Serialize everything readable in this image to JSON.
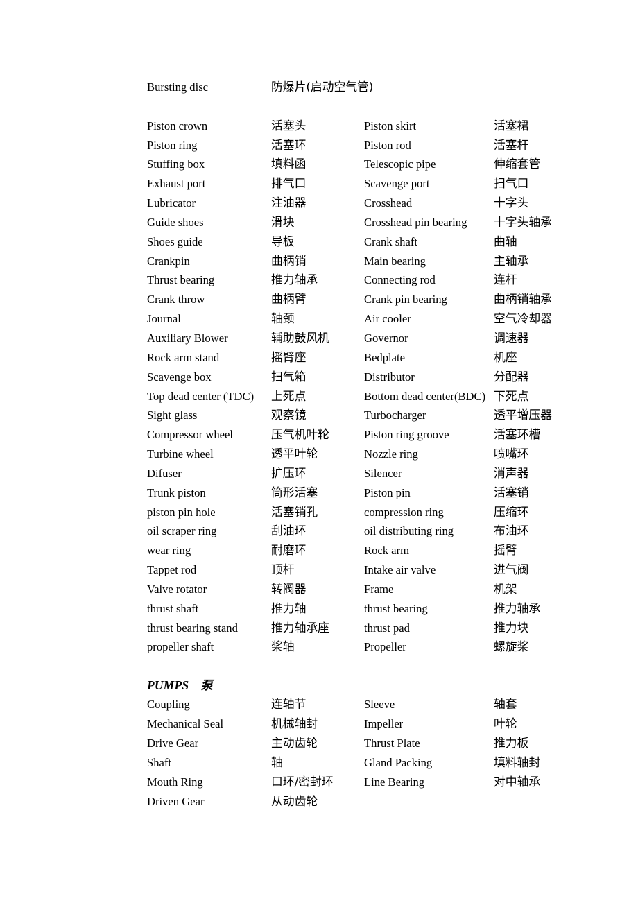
{
  "document": {
    "intro_row": {
      "en": "Bursting disc",
      "cn": "防爆片(启动空气管)"
    },
    "engine_rows": [
      {
        "en1": "Piston crown",
        "cn1": "活塞头",
        "en2": "Piston skirt",
        "cn2": "活塞裙"
      },
      {
        "en1": "Piston ring",
        "cn1": "活塞环",
        "en2": "Piston rod",
        "cn2": "活塞杆"
      },
      {
        "en1": "Stuffing box",
        "cn1": "填料函",
        "en2": "Telescopic pipe",
        "cn2": "伸缩套管"
      },
      {
        "en1": "Exhaust port",
        "cn1": "排气口",
        "en2": "Scavenge port",
        "cn2": "扫气口"
      },
      {
        "en1": "Lubricator",
        "cn1": "注油器",
        "en2": "Crosshead",
        "cn2": "十字头"
      },
      {
        "en1": "Guide shoes",
        "cn1": "滑块",
        "en2": "Crosshead pin bearing",
        "cn2": "十字头轴承"
      },
      {
        "en1": "Shoes guide",
        "cn1": "导板",
        "en2": "Crank shaft",
        "cn2": "曲轴"
      },
      {
        "en1": "Crankpin",
        "cn1": "曲柄销",
        "en2": "Main bearing",
        "cn2": "主轴承"
      },
      {
        "en1": "Thrust bearing",
        "cn1": "推力轴承",
        "en2": "Connecting rod",
        "cn2": "连杆"
      },
      {
        "en1": "Crank throw",
        "cn1": "曲柄臂",
        "en2": "Crank pin bearing",
        "cn2": "曲柄销轴承"
      },
      {
        "en1": "Journal",
        "cn1": "轴颈",
        "en2": "Air cooler",
        "cn2": "空气冷却器"
      },
      {
        "en1": "Auxiliary Blower",
        "cn1": "辅助鼓风机",
        "en2": "Governor",
        "cn2": "调速器"
      },
      {
        "en1": "Rock arm stand",
        "cn1": "摇臂座",
        "en2": "Bedplate",
        "cn2": "机座"
      },
      {
        "en1": "Scavenge box",
        "cn1": "扫气箱",
        "en2": "Distributor",
        "cn2": "分配器"
      },
      {
        "en1": "Top dead center (TDC)",
        "cn1": "上死点",
        "en2": "Bottom dead center(BDC)",
        "cn2": "下死点"
      },
      {
        "en1": "Sight glass",
        "cn1": "观察镜",
        "en2": "Turbocharger",
        "cn2": "透平增压器"
      },
      {
        "en1": "Compressor wheel",
        "cn1": "压气机叶轮",
        "en2": "Piston ring groove",
        "cn2": "活塞环槽"
      },
      {
        "en1": "Turbine wheel",
        "cn1": "透平叶轮",
        "en2": "Nozzle ring",
        "cn2": "喷嘴环"
      },
      {
        "en1": "Difuser",
        "cn1": "扩压环",
        "en2": "Silencer",
        "cn2": "消声器"
      },
      {
        "en1": "Trunk piston",
        "cn1": "筒形活塞",
        "en2": "Piston pin",
        "cn2": "活塞销"
      },
      {
        "en1": "piston pin hole",
        "cn1": "活塞销孔",
        "en2": "compression ring",
        "cn2": "压缩环"
      },
      {
        "en1": "oil scraper ring",
        "cn1": "刮油环",
        "en2": "oil distributing ring",
        "cn2": "布油环"
      },
      {
        "en1": "wear ring",
        "cn1": "耐磨环",
        "en2": "Rock arm",
        "cn2": "摇臂"
      },
      {
        "en1": "Tappet rod",
        "cn1": "顶杆",
        "en2": "Intake air valve",
        "cn2": "进气阀"
      },
      {
        "en1": "Valve rotator",
        "cn1": "转阀器",
        "en2": "Frame",
        "cn2": "机架"
      },
      {
        "en1": "thrust shaft",
        "cn1": "推力轴",
        "en2": "thrust bearing",
        "cn2": "推力轴承"
      },
      {
        "en1": "thrust bearing stand",
        "cn1": "推力轴承座",
        "en2": "thrust pad",
        "cn2": "推力块"
      },
      {
        "en1": "propeller shaft",
        "cn1": "桨轴",
        "en2": "Propeller",
        "cn2": "螺旋桨"
      }
    ],
    "pumps_heading": {
      "en": "PUMPS",
      "cn": "泵"
    },
    "pumps_rows": [
      {
        "en1": "Coupling",
        "cn1": "连轴节",
        "en2": "Sleeve",
        "cn2": "轴套"
      },
      {
        "en1": "Mechanical Seal",
        "cn1": "机械轴封",
        "en2": "Impeller",
        "cn2": "叶轮"
      },
      {
        "en1": "Drive Gear",
        "cn1": "主动齿轮",
        "en2": "Thrust Plate",
        "cn2": "推力板"
      },
      {
        "en1": "Shaft",
        "cn1": "轴",
        "en2": "Gland Packing",
        "cn2": "填料轴封"
      },
      {
        "en1": "Mouth Ring",
        "cn1": "口环/密封环",
        "en2": "Line Bearing",
        "cn2": "对中轴承"
      },
      {
        "en1": "Driven Gear",
        "cn1": "从动齿轮",
        "en2": "",
        "cn2": ""
      }
    ]
  }
}
